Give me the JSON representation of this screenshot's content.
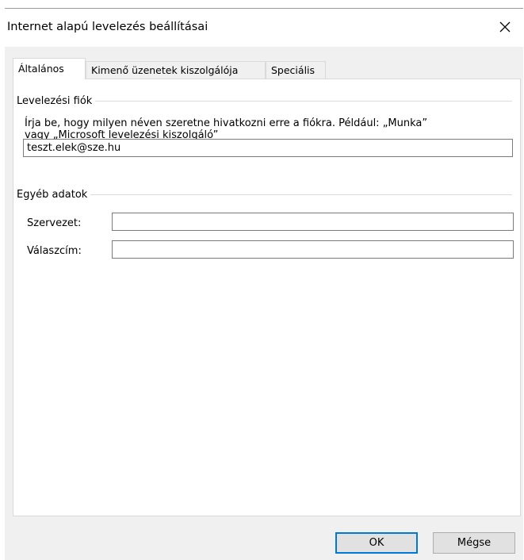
{
  "window": {
    "title": "Internet alapú levelezés beállításai",
    "close_icon": "close-icon"
  },
  "tabs": [
    {
      "label": "Általános",
      "active": true
    },
    {
      "label": "Kimenő üzenetek kiszolgálója",
      "active": false
    },
    {
      "label": "Speciális",
      "active": false
    }
  ],
  "account_group": {
    "header": "Levelezési fiók",
    "description_line1": "Írja be, hogy milyen néven szeretne hivatkozni erre a fiókra. Például: „Munka”",
    "description_line2": "vagy „Microsoft levelezési kiszolgáló”",
    "account_name_value": "teszt.elek@sze.hu"
  },
  "other_group": {
    "header": "Egyéb adatok",
    "organization_label": "Szervezet:",
    "organization_value": "",
    "reply_label": "Válaszcím:",
    "reply_value": ""
  },
  "buttons": {
    "ok_label": "OK",
    "cancel_label": "Mégse"
  },
  "colors": {
    "accent": "#0078d7",
    "dialog_bg": "#f0f0f0"
  }
}
